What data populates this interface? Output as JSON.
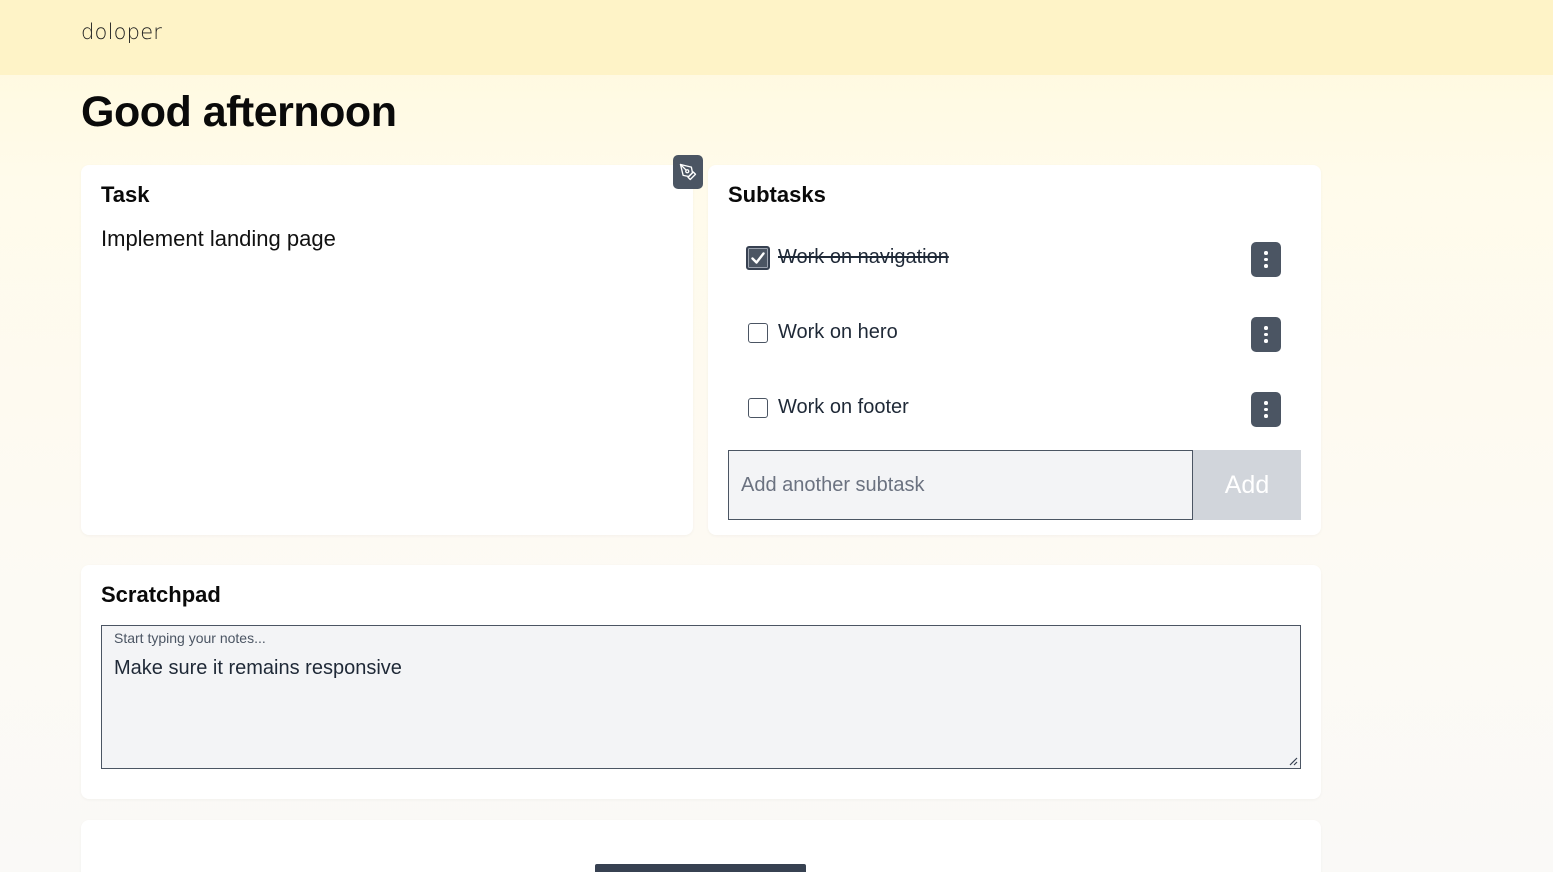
{
  "app": {
    "logo": "doloper"
  },
  "greeting": "Good afternoon",
  "task": {
    "title": "Task",
    "text": "Implement landing page",
    "edit_icon": "pen-icon"
  },
  "subtasks": {
    "title": "Subtasks",
    "items": [
      {
        "label": "Work on navigation",
        "checked": true
      },
      {
        "label": "Work on hero",
        "checked": false
      },
      {
        "label": "Work on footer",
        "checked": false
      }
    ],
    "menu_icon": "kebab-menu-icon",
    "add_placeholder": "Add another subtask",
    "add_value": "",
    "add_label": "Add"
  },
  "scratchpad": {
    "title": "Scratchpad",
    "placeholder": "Start typing your notes...",
    "text": "Make sure it remains responsive"
  },
  "colors": {
    "header_bg": "#fef3c7",
    "accent_dark": "#4b5563",
    "add_button_disabled": "#d1d5db"
  }
}
